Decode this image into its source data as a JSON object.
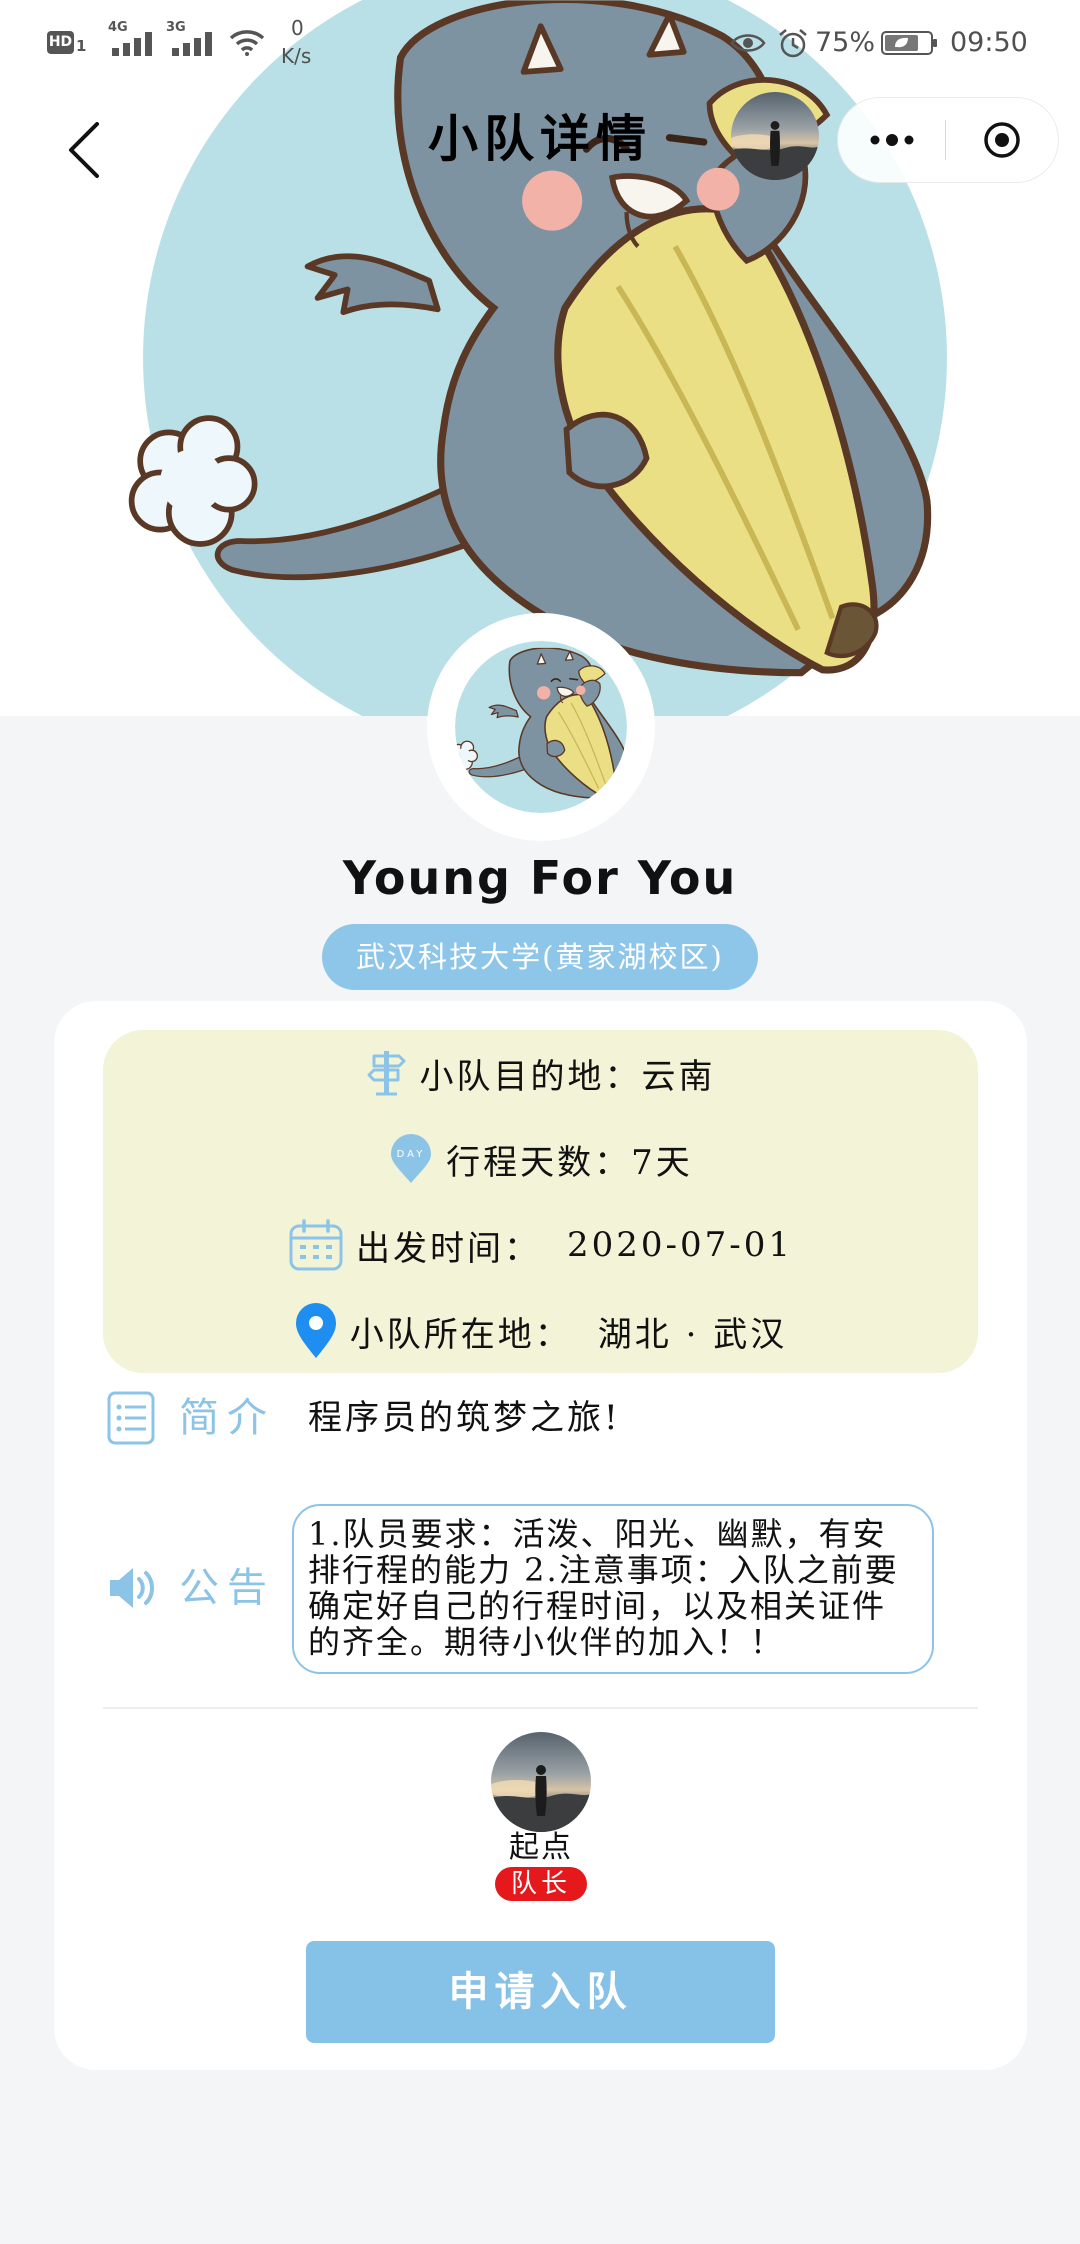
{
  "status_bar": {
    "hd": "HD",
    "sim": "1",
    "net1": "4G",
    "net2": "3G",
    "speed_value": "0",
    "speed_unit": "K/s",
    "battery": "75%",
    "battery_level": 0.75,
    "time": "09:50"
  },
  "nav": {
    "title": "小队详情"
  },
  "team": {
    "name": "Young For You",
    "school": "武汉科技大学(黄家湖校区)"
  },
  "info": {
    "destination_label": "小队目的地：",
    "destination": "云南",
    "days_label": "行程天数：",
    "days": "7天",
    "day_icon_text": "DAY",
    "departure_label": "出发时间：",
    "departure": "2020-07-01",
    "location_label": "小队所在地：",
    "location": "湖北 · 武汉"
  },
  "intro": {
    "label": "简介",
    "text": "程序员的筑梦之旅!"
  },
  "notice": {
    "label": "公告",
    "text": "1.队员要求：活泼、阳光、幽默，有安排行程的能力 2.注意事项：入队之前要确定好自己的行程时间，以及相关证件的齐全。期待小伙伴的加入！！"
  },
  "members": [
    {
      "name": "起点",
      "role": "队长"
    }
  ],
  "apply_button": "申请入队",
  "colors": {
    "accent": "#8cc4e8",
    "school_pill": "#8ec6ea",
    "info_box": "#f3f3d7",
    "badge": "#e5191b",
    "button": "#86c2e8",
    "page_bg": "#f4f5f7",
    "hero_circle": "#b9e0e6",
    "location_pin": "#1e8ff0"
  },
  "icons": {
    "back": "chevron-left-icon",
    "more": "more-dots-icon",
    "close": "target-icon",
    "destination": "signpost-icon",
    "days": "day-pin-icon",
    "departure": "calendar-icon",
    "location": "location-pin-icon",
    "intro": "list-icon",
    "notice": "speaker-icon"
  }
}
